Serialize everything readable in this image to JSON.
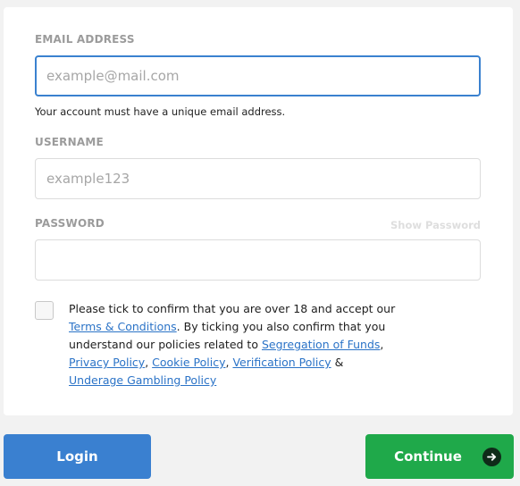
{
  "email": {
    "label": "EMAIL ADDRESS",
    "placeholder": "example@mail.com",
    "value": "",
    "hint": "Your account must have a unique email address."
  },
  "username": {
    "label": "USERNAME",
    "placeholder": "example123",
    "value": ""
  },
  "password": {
    "label": "PASSWORD",
    "placeholder": "",
    "value": "",
    "show_label": "Show Password"
  },
  "terms": {
    "checked": false,
    "text_1": "Please tick to confirm that you are over 18 and accept our ",
    "link_terms": "Terms & Conditions",
    "text_2": ". By ticking you also confirm that you understand our policies related to ",
    "link_segregation": "Segregation of Funds",
    "text_3": ", ",
    "link_privacy": "Privacy Policy",
    "text_4": ", ",
    "link_cookie": "Cookie Policy",
    "text_5": ", ",
    "link_verification": "Verification Policy",
    "text_6": " & ",
    "link_gambling": "Underage Gambling Policy"
  },
  "buttons": {
    "login_label": "Login",
    "continue_label": "Continue",
    "continue_icon": "arrow-right-icon"
  },
  "colors": {
    "primary_blue": "#3a80d0",
    "continue_green": "#1fa94a",
    "link_blue": "#2b73c7",
    "focus_border": "#3a81cf"
  }
}
